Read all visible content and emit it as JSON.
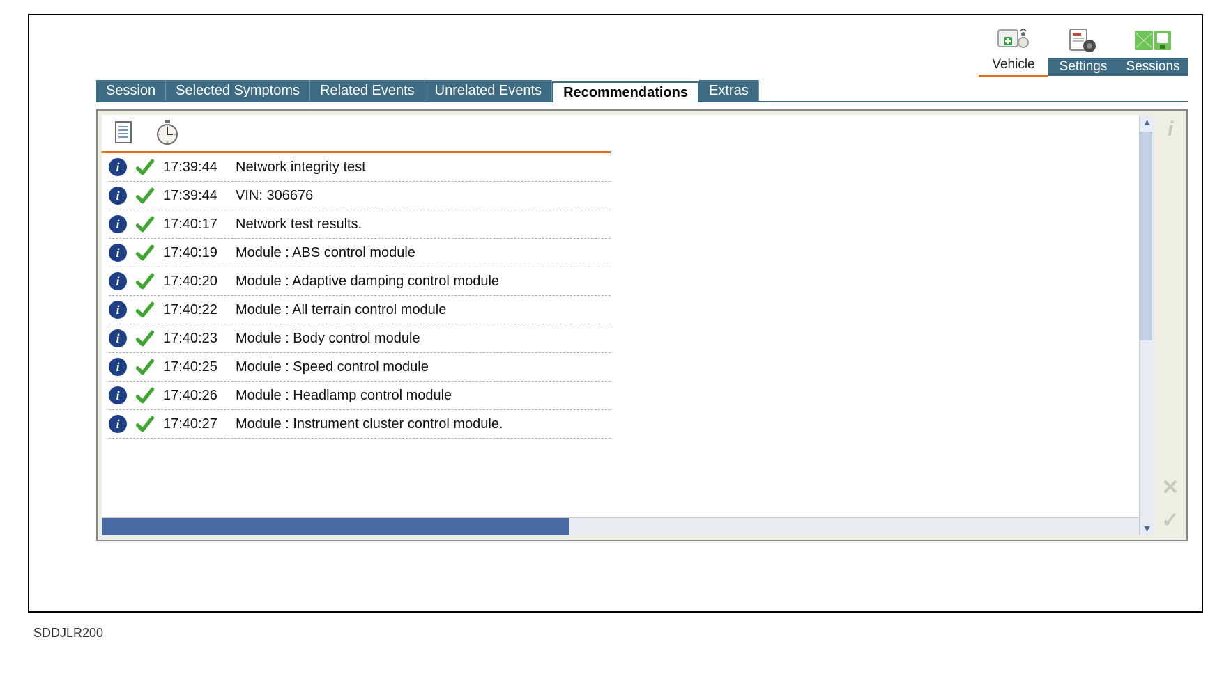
{
  "caption": "SDDJLR200",
  "toolbar": {
    "items": [
      {
        "id": "vehicle",
        "label": "Vehicle",
        "active": true
      },
      {
        "id": "settings",
        "label": "Settings",
        "active": false
      },
      {
        "id": "sessions",
        "label": "Sessions",
        "active": false
      }
    ]
  },
  "tabs": [
    {
      "id": "session",
      "label": "Session",
      "active": false
    },
    {
      "id": "selected-symptoms",
      "label": "Selected Symptoms",
      "active": false
    },
    {
      "id": "related-events",
      "label": "Related Events",
      "active": false
    },
    {
      "id": "unrelated-events",
      "label": "Unrelated Events",
      "active": false
    },
    {
      "id": "recommendations",
      "label": "Recommendations",
      "active": true
    },
    {
      "id": "extras",
      "label": "Extras",
      "active": false
    }
  ],
  "list": {
    "rows": [
      {
        "time": "17:39:44",
        "desc": "Network integrity test"
      },
      {
        "time": "17:39:44",
        "desc": "VIN: 306676"
      },
      {
        "time": "17:40:17",
        "desc": "Network test results."
      },
      {
        "time": "17:40:19",
        "desc": "Module : ABS control module"
      },
      {
        "time": "17:40:20",
        "desc": "Module : Adaptive damping control module"
      },
      {
        "time": "17:40:22",
        "desc": "Module : All terrain control module"
      },
      {
        "time": "17:40:23",
        "desc": "Module : Body control module"
      },
      {
        "time": "17:40:25",
        "desc": "Module : Speed control module"
      },
      {
        "time": "17:40:26",
        "desc": "Module : Headlamp control module"
      },
      {
        "time": "17:40:27",
        "desc": "Module : Instrument cluster control module."
      }
    ]
  }
}
